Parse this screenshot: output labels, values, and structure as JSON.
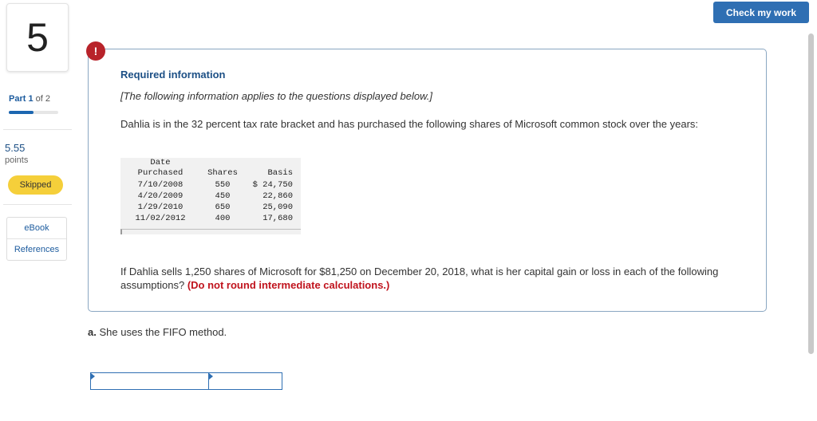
{
  "question_number": "5",
  "part": {
    "prefix": "Part",
    "current": "1",
    "of_text": "of 2",
    "progress_fraction": 0.5
  },
  "points": {
    "value": "5.55",
    "label": "points"
  },
  "status_badge": "Skipped",
  "side_links": [
    "eBook",
    "References"
  ],
  "check_button": "Check my work",
  "info": {
    "icon": "!",
    "title": "Required information",
    "note": "[The following information applies to the questions displayed below.]",
    "paragraph": "Dahlia is in the 32 percent tax rate bracket and has purchased the following shares of Microsoft common stock over the years:",
    "table": {
      "headers": {
        "date_line1": "Date",
        "date_line2": "Purchased",
        "shares": "Shares",
        "basis": "Basis"
      },
      "rows": [
        {
          "date": "7/10/2008",
          "shares": "550",
          "basis": "$ 24,750"
        },
        {
          "date": "4/20/2009",
          "shares": "450",
          "basis": "22,860"
        },
        {
          "date": "1/29/2010",
          "shares": "650",
          "basis": "25,090"
        },
        {
          "date": "11/02/2012",
          "shares": "400",
          "basis": "17,680"
        }
      ]
    },
    "question_text": "If Dahlia sells 1,250 shares of Microsoft for $81,250 on December 20, 2018, what is her capital gain or loss in each of the following assumptions?",
    "question_warning": "(Do not round intermediate calculations.)"
  },
  "part_a": {
    "label": "a.",
    "text": "She uses the FIFO method."
  },
  "answers": {
    "field_1": "",
    "field_2": ""
  }
}
